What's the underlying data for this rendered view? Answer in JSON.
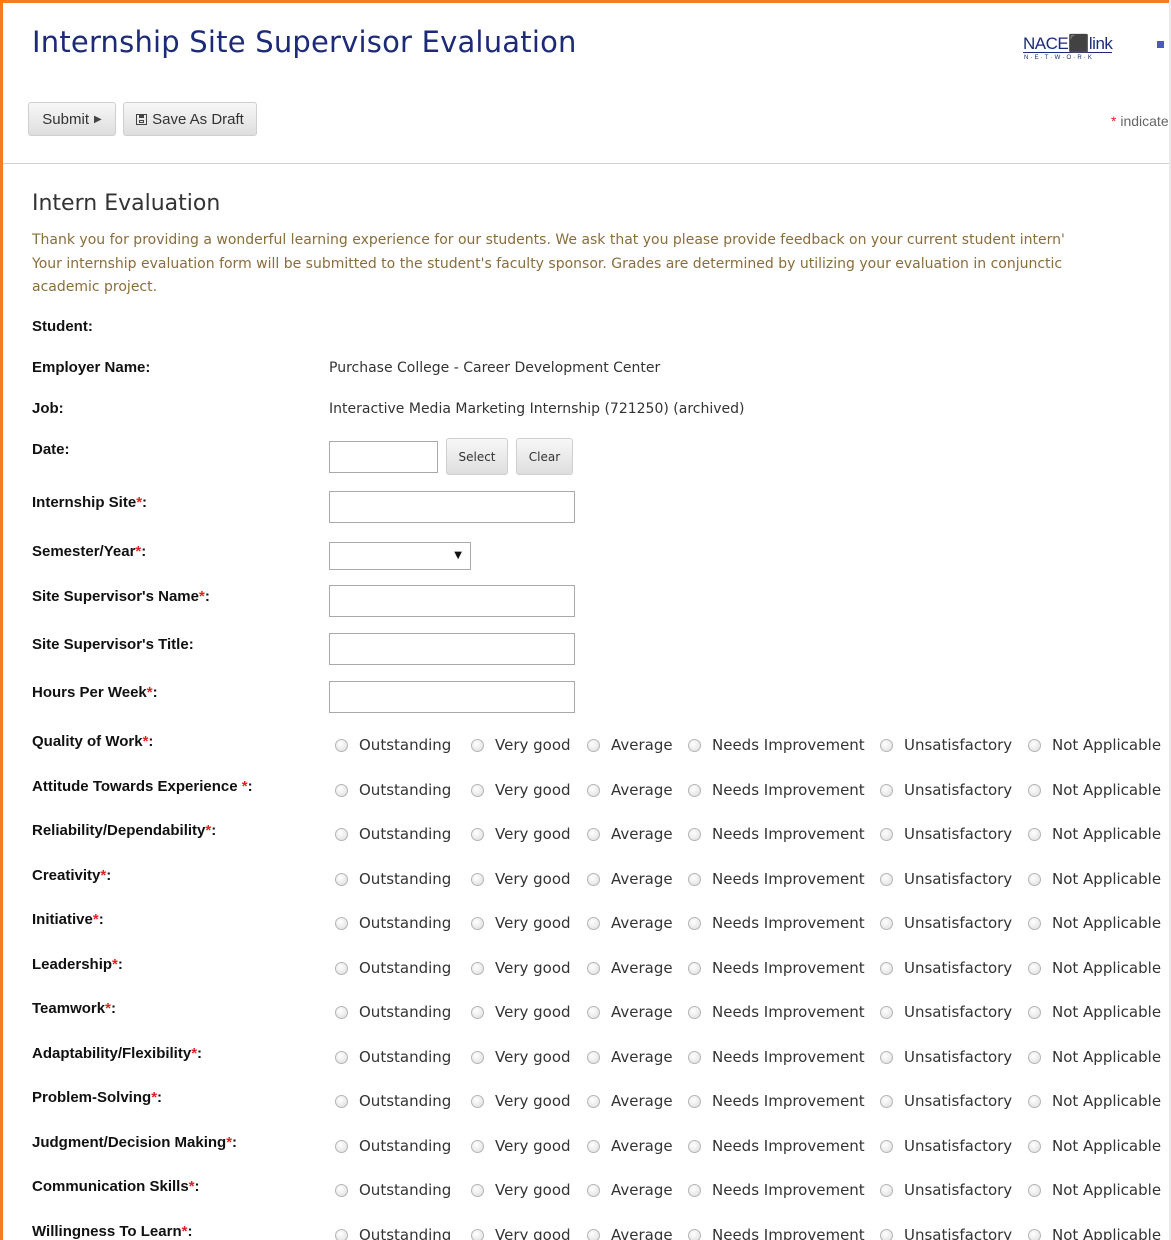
{
  "page": {
    "title": "Internship Site Supervisor Evaluation",
    "logo_main": "NACE⬛link",
    "logo_sub": "N·E·T·W·O·R·K"
  },
  "toolbar": {
    "submit_label": "Submit",
    "draft_label": "Save As Draft",
    "indicates_text": "indicate"
  },
  "section": {
    "title": "Intern Evaluation",
    "intro_lines": [
      "Thank you for providing a wonderful learning experience for our students. We ask that you please provide feedback on your current student intern'",
      "Your internship evaluation form will be submitted to the student's faculty sponsor. Grades are determined by utilizing your evaluation in conjunctic",
      "academic project."
    ]
  },
  "fields": {
    "student": {
      "label": "Student",
      "value": ""
    },
    "employer": {
      "label": "Employer Name",
      "value": "Purchase College - Career Development Center"
    },
    "job": {
      "label": "Job",
      "value": "Interactive Media Marketing Internship (721250) (archived)"
    },
    "date": {
      "label": "Date",
      "value": "",
      "select_label": "Select",
      "clear_label": "Clear"
    },
    "internship_site": {
      "label": "Internship Site",
      "value": ""
    },
    "semester": {
      "label": "Semester/Year",
      "value": ""
    },
    "supervisor_name": {
      "label": "Site Supervisor's Name",
      "value": ""
    },
    "supervisor_title": {
      "label": "Site Supervisor's Title",
      "value": ""
    },
    "hours": {
      "label": "Hours Per Week",
      "value": ""
    }
  },
  "rating_options": [
    "Outstanding",
    "Very good",
    "Average",
    "Needs Improvement",
    "Unsatisfactory",
    "Not Applicable"
  ],
  "ratings": [
    {
      "label": "Quality of Work",
      "suffix": ""
    },
    {
      "label": "Attitude Towards Experience ",
      "suffix": ""
    },
    {
      "label": "Reliability/Dependability",
      "suffix": ""
    },
    {
      "label": "Creativity",
      "suffix": ""
    },
    {
      "label": "Initiative",
      "suffix": ""
    },
    {
      "label": "Leadership",
      "suffix": ""
    },
    {
      "label": "Teamwork",
      "suffix": ""
    },
    {
      "label": "Adaptability/Flexibility",
      "suffix": ""
    },
    {
      "label": "Problem-Solving",
      "suffix": ""
    },
    {
      "label": "Judgment/Decision Making",
      "suffix": ""
    },
    {
      "label": "Communication Skills",
      "suffix": ""
    },
    {
      "label": "Willingness To Learn",
      "suffix": ""
    }
  ],
  "colors": {
    "accent_border": "#f57c1f",
    "title_color": "#1c2a78",
    "intro_color": "#8a6d3b",
    "required_star": "#dd2222"
  }
}
